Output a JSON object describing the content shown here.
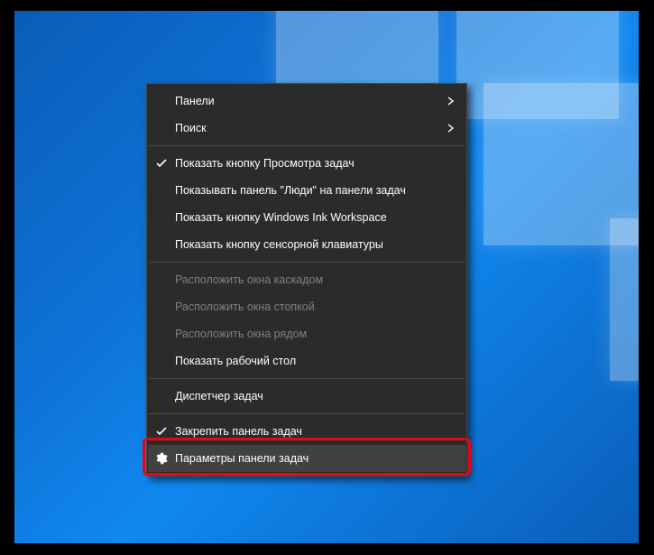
{
  "menu": {
    "items": [
      {
        "label": "Панели",
        "submenu": true
      },
      {
        "label": "Поиск",
        "submenu": true
      }
    ],
    "group2": [
      {
        "label": "Показать кнопку Просмотра задач",
        "checked": true
      },
      {
        "label": "Показывать панель \"Люди\" на панели задач"
      },
      {
        "label": "Показать кнопку Windows Ink Workspace"
      },
      {
        "label": "Показать кнопку сенсорной клавиатуры"
      }
    ],
    "group3": [
      {
        "label": "Расположить окна каскадом",
        "disabled": true
      },
      {
        "label": "Расположить окна стопкой",
        "disabled": true
      },
      {
        "label": "Расположить окна рядом",
        "disabled": true
      },
      {
        "label": "Показать рабочий стол"
      }
    ],
    "group4": [
      {
        "label": "Диспетчер задач"
      }
    ],
    "group5": [
      {
        "label": "Закрепить панель задач",
        "checked": true
      },
      {
        "label": "Параметры панели задач",
        "icon": "gear",
        "hover": true,
        "highlight": true
      }
    ]
  }
}
